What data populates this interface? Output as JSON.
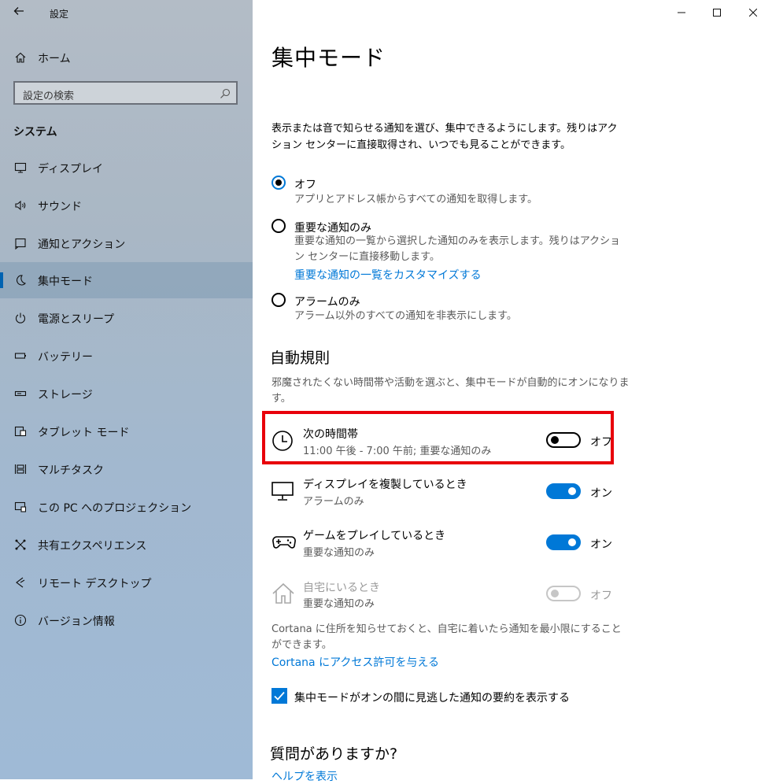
{
  "app": {
    "title": "設定"
  },
  "sidebar": {
    "home_label": "ホーム",
    "search_placeholder": "設定の検索",
    "section": "システム",
    "items": [
      {
        "label": "ディスプレイ",
        "icon": "monitor-icon"
      },
      {
        "label": "サウンド",
        "icon": "speaker-icon"
      },
      {
        "label": "通知とアクション",
        "icon": "notification-icon"
      },
      {
        "label": "集中モード",
        "icon": "moon-icon",
        "active": true
      },
      {
        "label": "電源とスリープ",
        "icon": "power-icon"
      },
      {
        "label": "バッテリー",
        "icon": "battery-icon"
      },
      {
        "label": "ストレージ",
        "icon": "storage-icon"
      },
      {
        "label": "タブレット モード",
        "icon": "tablet-icon"
      },
      {
        "label": "マルチタスク",
        "icon": "multitask-icon"
      },
      {
        "label": "この PC へのプロジェクション",
        "icon": "projection-icon"
      },
      {
        "label": "共有エクスペリエンス",
        "icon": "share-icon"
      },
      {
        "label": "リモート デスクトップ",
        "icon": "remote-icon"
      },
      {
        "label": "バージョン情報",
        "icon": "info-icon"
      }
    ]
  },
  "main": {
    "title": "集中モード",
    "intro": "表示または音で知らせる通知を選び、集中できるようにします。残りはアクション センターに直接取得され、いつでも見ることができます。",
    "options": [
      {
        "label": "オフ",
        "desc": "アプリとアドレス帳からすべての通知を取得します。",
        "checked": true
      },
      {
        "label": "重要な通知のみ",
        "desc": "重要な通知の一覧から選択した通知のみを表示します。残りはアクション センターに直接移動します。",
        "link": "重要な通知の一覧をカスタマイズする",
        "checked": false
      },
      {
        "label": "アラームのみ",
        "desc": "アラーム以外のすべての通知を非表示にします。",
        "checked": false
      }
    ],
    "auto_rules": {
      "heading": "自動規則",
      "desc": "邪魔されたくない時間帯や活動を選ぶと、集中モードが自動的にオンになります。",
      "rules": [
        {
          "title": "次の時間帯",
          "sub": "11:00 午後 - 7:00 午前; 重要な通知のみ",
          "state": "オフ",
          "on": false,
          "icon": "clock-icon"
        },
        {
          "title": "ディスプレイを複製しているとき",
          "sub": "アラームのみ",
          "state": "オン",
          "on": true,
          "icon": "monitor-icon"
        },
        {
          "title": "ゲームをプレイしているとき",
          "sub": "重要な通知のみ",
          "state": "オン",
          "on": true,
          "icon": "gamepad-icon"
        },
        {
          "title": "自宅にいるとき",
          "sub": "重要な通知のみ",
          "state": "オフ",
          "on": false,
          "disabled": true,
          "icon": "home-icon"
        }
      ],
      "cortana_note": "Cortana に住所を知らせておくと、自宅に着いたら通知を最小限にすることができます。",
      "cortana_link": "Cortana にアクセス許可を与える"
    },
    "summary_checkbox": {
      "label": "集中モードがオンの間に見逃した通知の要約を表示する",
      "checked": true
    },
    "questions": {
      "heading": "質問がありますか?",
      "help_link": "ヘルプを表示"
    }
  },
  "colors": {
    "accent": "#0078d7",
    "highlight": "#e8000b"
  }
}
